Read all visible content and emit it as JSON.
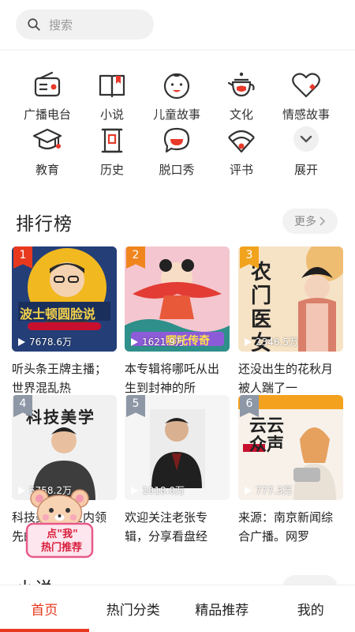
{
  "search": {
    "placeholder": "搜索"
  },
  "categories": [
    {
      "label": "广播电台",
      "icon": "radio-icon"
    },
    {
      "label": "小说",
      "icon": "book-icon"
    },
    {
      "label": "儿童故事",
      "icon": "child-face-icon"
    },
    {
      "label": "文化",
      "icon": "teapot-icon"
    },
    {
      "label": "情感故事",
      "icon": "heart-icon"
    },
    {
      "label": "教育",
      "icon": "graduation-cap-icon"
    },
    {
      "label": "历史",
      "icon": "scroll-icon"
    },
    {
      "label": "脱口秀",
      "icon": "speech-bubble-icon"
    },
    {
      "label": "评书",
      "icon": "fan-icon"
    },
    {
      "label": "展开",
      "icon": "chevron-down-icon"
    }
  ],
  "ranking": {
    "title": "排行榜",
    "more": "更多",
    "items": [
      {
        "rank": "1",
        "plays": "7678.6万",
        "title": "听头条王牌主播；世界混乱热",
        "cover_text": "波士顿圆脸说"
      },
      {
        "rank": "2",
        "plays": "1621.9万",
        "title": "本专辑将哪吒从出生到封神的所",
        "cover_text": "哪吒传奇"
      },
      {
        "rank": "3",
        "plays": "2346.5万",
        "title": "还没出生的花秋月被人踹了一",
        "cover_text": "农门医女"
      },
      {
        "rank": "4",
        "plays": "5758.2万",
        "title": "科技美学行业内领先的数码媒",
        "cover_text": "科技美学"
      },
      {
        "rank": "5",
        "plays": "1018.0万",
        "title": "欢迎关注老张专辑，分享看盘经",
        "cover_text": ""
      },
      {
        "rank": "6",
        "plays": "777.3万",
        "title": "来源：南京新闻综合广播。网罗",
        "cover_text": "云云众声"
      }
    ]
  },
  "next_section": {
    "title": "小说"
  },
  "floating": {
    "line1": "点\"我\"",
    "line2": "热门推荐"
  },
  "tabs": [
    {
      "label": "首页",
      "active": true
    },
    {
      "label": "热门分类",
      "active": false
    },
    {
      "label": "精品推荐",
      "active": false
    },
    {
      "label": "我的",
      "active": false
    }
  ],
  "colors": {
    "accent": "#e8391e",
    "icon_red": "#e8392b"
  }
}
